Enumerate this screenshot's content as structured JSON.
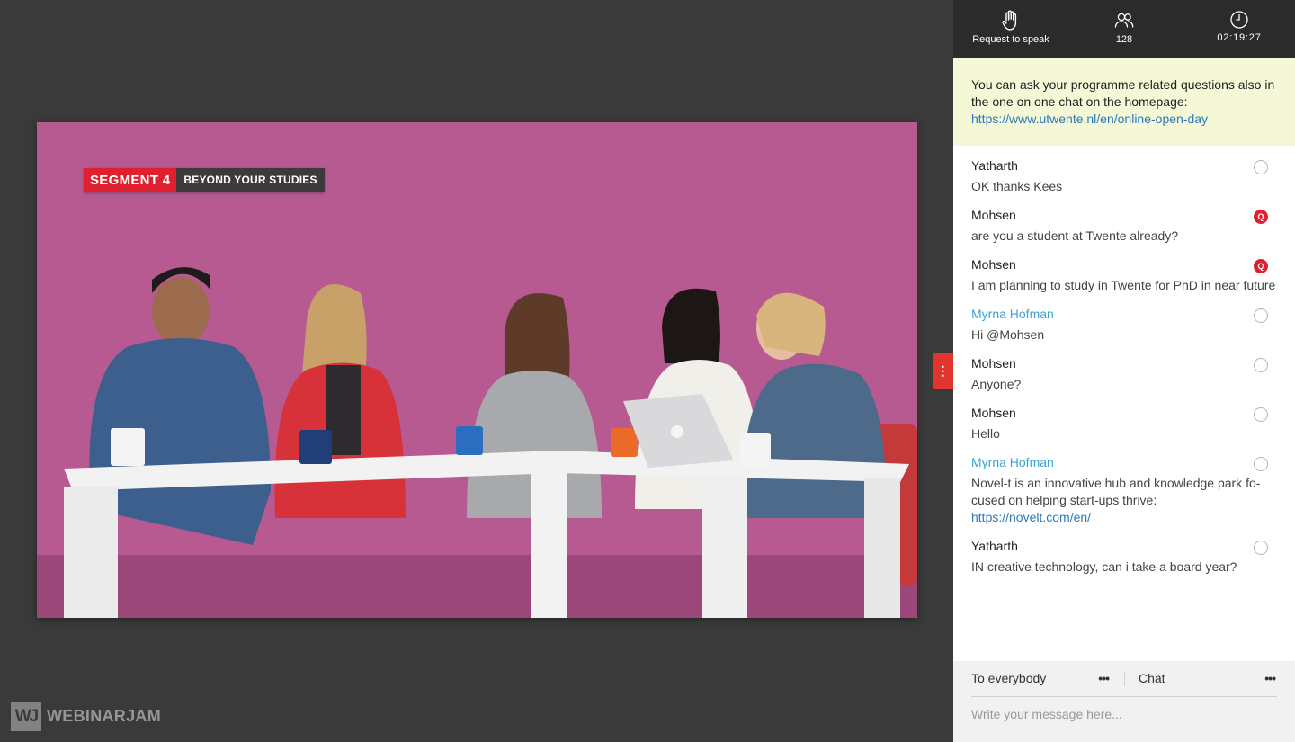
{
  "video": {
    "segment_label": "SEGMENT 4",
    "segment_title": "BEYOND YOUR STUDIES"
  },
  "brand": {
    "logo_mark": "WJ",
    "name": "WEBINARJAM"
  },
  "toolbar": {
    "request_label": "Request to speak",
    "attendee_count": "128",
    "elapsed_time": "02:19:27"
  },
  "notice": {
    "text": "You can ask your programme related questions also in the one on one chat on the homepage:",
    "link": "https://www.utwente.nl/en/online-open-day"
  },
  "messages": [
    {
      "name": "Yatharth",
      "text": "OK thanks Kees",
      "status": "none"
    },
    {
      "name": "Mohsen",
      "text": "are you a student at Twente already?",
      "status": "question",
      "badge": "Q"
    },
    {
      "name": "Mohsen",
      "text": "I am planning to study in Twente for PhD in near future",
      "status": "question",
      "badge": "Q"
    },
    {
      "name": "Myrna Hofman",
      "text": "Hi @Mohsen",
      "status": "none"
    },
    {
      "name": "Mohsen",
      "text": "Anyone?",
      "status": "none"
    },
    {
      "name": "Mohsen",
      "text": "Hello",
      "status": "none"
    },
    {
      "name": "Myrna Hofman",
      "text": "Novel-t is an innovative hub and knowledge park fo-cused on helping start-ups thrive:",
      "link": "https://novelt.com/en/",
      "status": "none"
    },
    {
      "name": "Yatharth",
      "text": "IN creative technology, can i take a board year?",
      "status": "none"
    }
  ],
  "footer": {
    "recipient": "To everybody",
    "mode": "Chat",
    "more": "•••",
    "placeholder": "Write your message here..."
  },
  "colors": {
    "accent_red": "#e0202e",
    "moderator_blue": "#3aa3d6",
    "link_blue": "#2c7ab8",
    "notice_bg": "#f5f8d6",
    "video_bg": "#b85a92"
  }
}
